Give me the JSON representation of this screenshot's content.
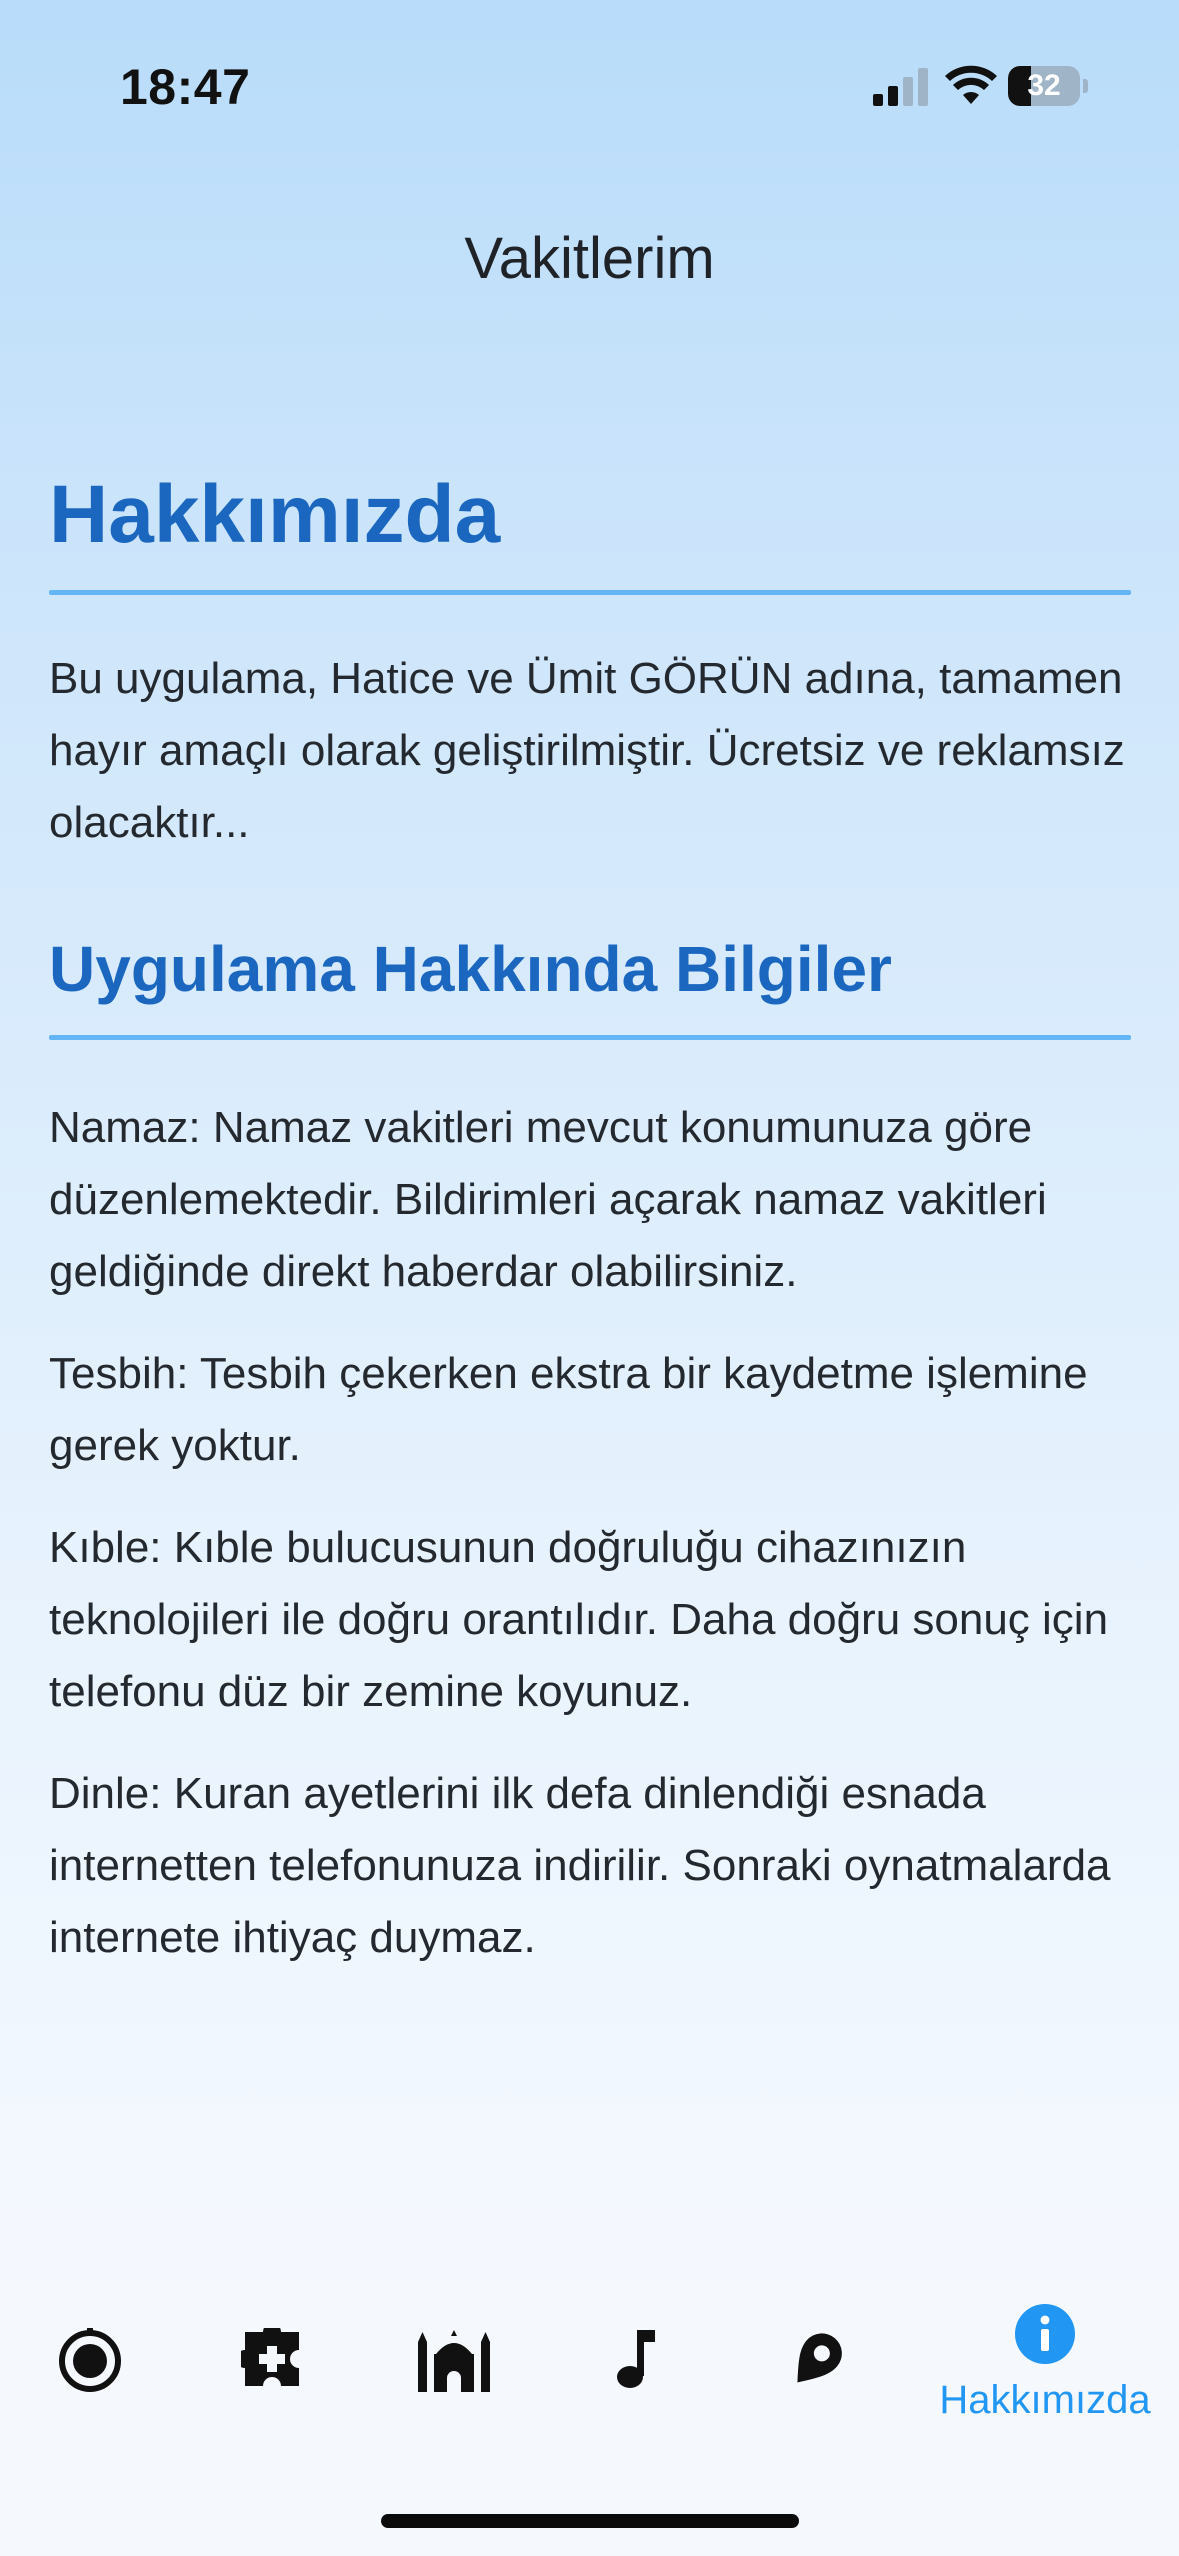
{
  "status_bar": {
    "time": "18:47",
    "battery_percent": 32,
    "battery_text": "32",
    "icons": [
      "signal-icon",
      "wifi-icon",
      "battery-icon"
    ]
  },
  "header": {
    "title": "Vakitlerim"
  },
  "about": {
    "heading": "Hakkımızda",
    "intro": "Bu uygulama, Hatice ve Ümit GÖRÜN adına, tamamen hayır amaçlı olarak geliştirilmiştir. Ücretsiz ve reklamsız olacaktır...",
    "info_heading": "Uygulama Hakkında Bilgiler",
    "items": [
      "Namaz: Namaz vakitleri mevcut konumunuza göre düzenlemektedir. Bildirimleri açarak namaz vakitleri geldiğinde direkt haberdar olabilirsiniz.",
      "Tesbih: Tesbih çekerken ekstra bir kaydetme işlemine gerek yoktur.",
      "Kıble: Kıble bulucusunun doğruluğu cihazınızın teknolojileri ile doğru orantılıdır. Daha doğru sonuç için telefonu düz bir zemine koyunuz.",
      "Dinle: Kuran ayetlerini ilk defa dinlendiği esnada internetten telefonunuza indirilir. Sonraki oynatmalarda internete ihtiyaç duymaz."
    ]
  },
  "bottom_nav": {
    "items": [
      {
        "icon": "target-icon",
        "label": ""
      },
      {
        "icon": "puzzle-icon",
        "label": ""
      },
      {
        "icon": "mosque-icon",
        "label": ""
      },
      {
        "icon": "music-note-icon",
        "label": ""
      },
      {
        "icon": "location-pin-icon",
        "label": ""
      },
      {
        "icon": "info-icon",
        "label": "Hakkımızda",
        "active": true
      }
    ],
    "active_color": "#2196f3",
    "inactive_color": "#111111"
  },
  "colors": {
    "heading": "#1b67c0",
    "divider": "#64b5f6",
    "background_top": "#b8dcfa",
    "background_bottom": "#f7fafe"
  }
}
